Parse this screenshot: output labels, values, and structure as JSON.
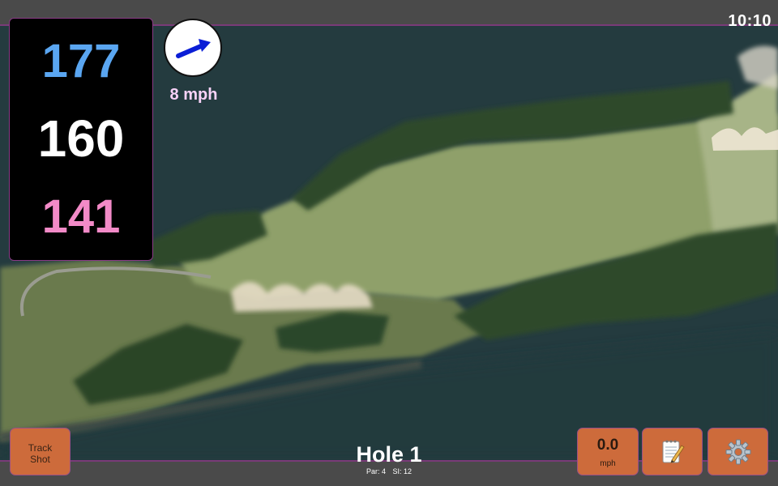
{
  "clock": "10:10",
  "distances": {
    "back": "177",
    "middle": "160",
    "front": "141",
    "colors": {
      "back": "#5aa6f1",
      "middle": "#ffffff",
      "front": "#f28ac7"
    }
  },
  "wind": {
    "speed_label": "8 mph",
    "direction_icon": "arrow-right-up-icon",
    "arrow_color": "#0b1ed6"
  },
  "buttons": {
    "track_shot_line1": "Track",
    "track_shot_line2": "Shot",
    "speed_value": "0.0",
    "speed_unit": "mph",
    "notes_icon": "notepad-icon",
    "settings_icon": "gear-icon",
    "color": "#cd6b3b"
  },
  "hole": {
    "title": "Hole 1",
    "par": "Par: 4",
    "si": "SI: 12"
  },
  "map": {
    "water_color": "#233a3e",
    "fairway_color": "#8fa06a",
    "trees_color": "#2e4a2a",
    "sand_color": "#e6dcc6"
  }
}
